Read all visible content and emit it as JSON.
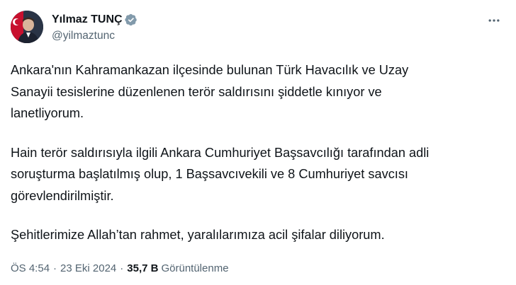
{
  "author": {
    "display_name": "Yılmaz TUNÇ",
    "handle": "@yilmaztunc",
    "verified_badge_color": "#829aab",
    "avatar_icon": "profile-photo"
  },
  "tweet": {
    "paragraphs": [
      "Ankara'nın Kahramankazan ilçesinde bulunan Türk Havacılık ve Uzay\nSanayii tesislerine düzenlenen terör saldırısını şiddetle kınıyor ve\nlanetliyorum.",
      "Hain terör saldırısıyla ilgili Ankara Cumhuriyet Başsavcılığı tarafından adli\nsoruşturma başlatılmış olup, 1 Başsavcıvekili ve 8 Cumhuriyet savcısı\ngörevlendirilmiştir.",
      "Şehitlerimize Allah’tan rahmet, yaralılarımıza acil şifalar diliyorum."
    ]
  },
  "meta": {
    "time": "ÖS 4:54",
    "separator": "·",
    "date": "23 Eki 2024",
    "views_count": "35,7 B",
    "views_label": "Görüntülenme"
  },
  "colors": {
    "text": "#0f1419",
    "secondary": "#536471",
    "background": "#ffffff"
  }
}
